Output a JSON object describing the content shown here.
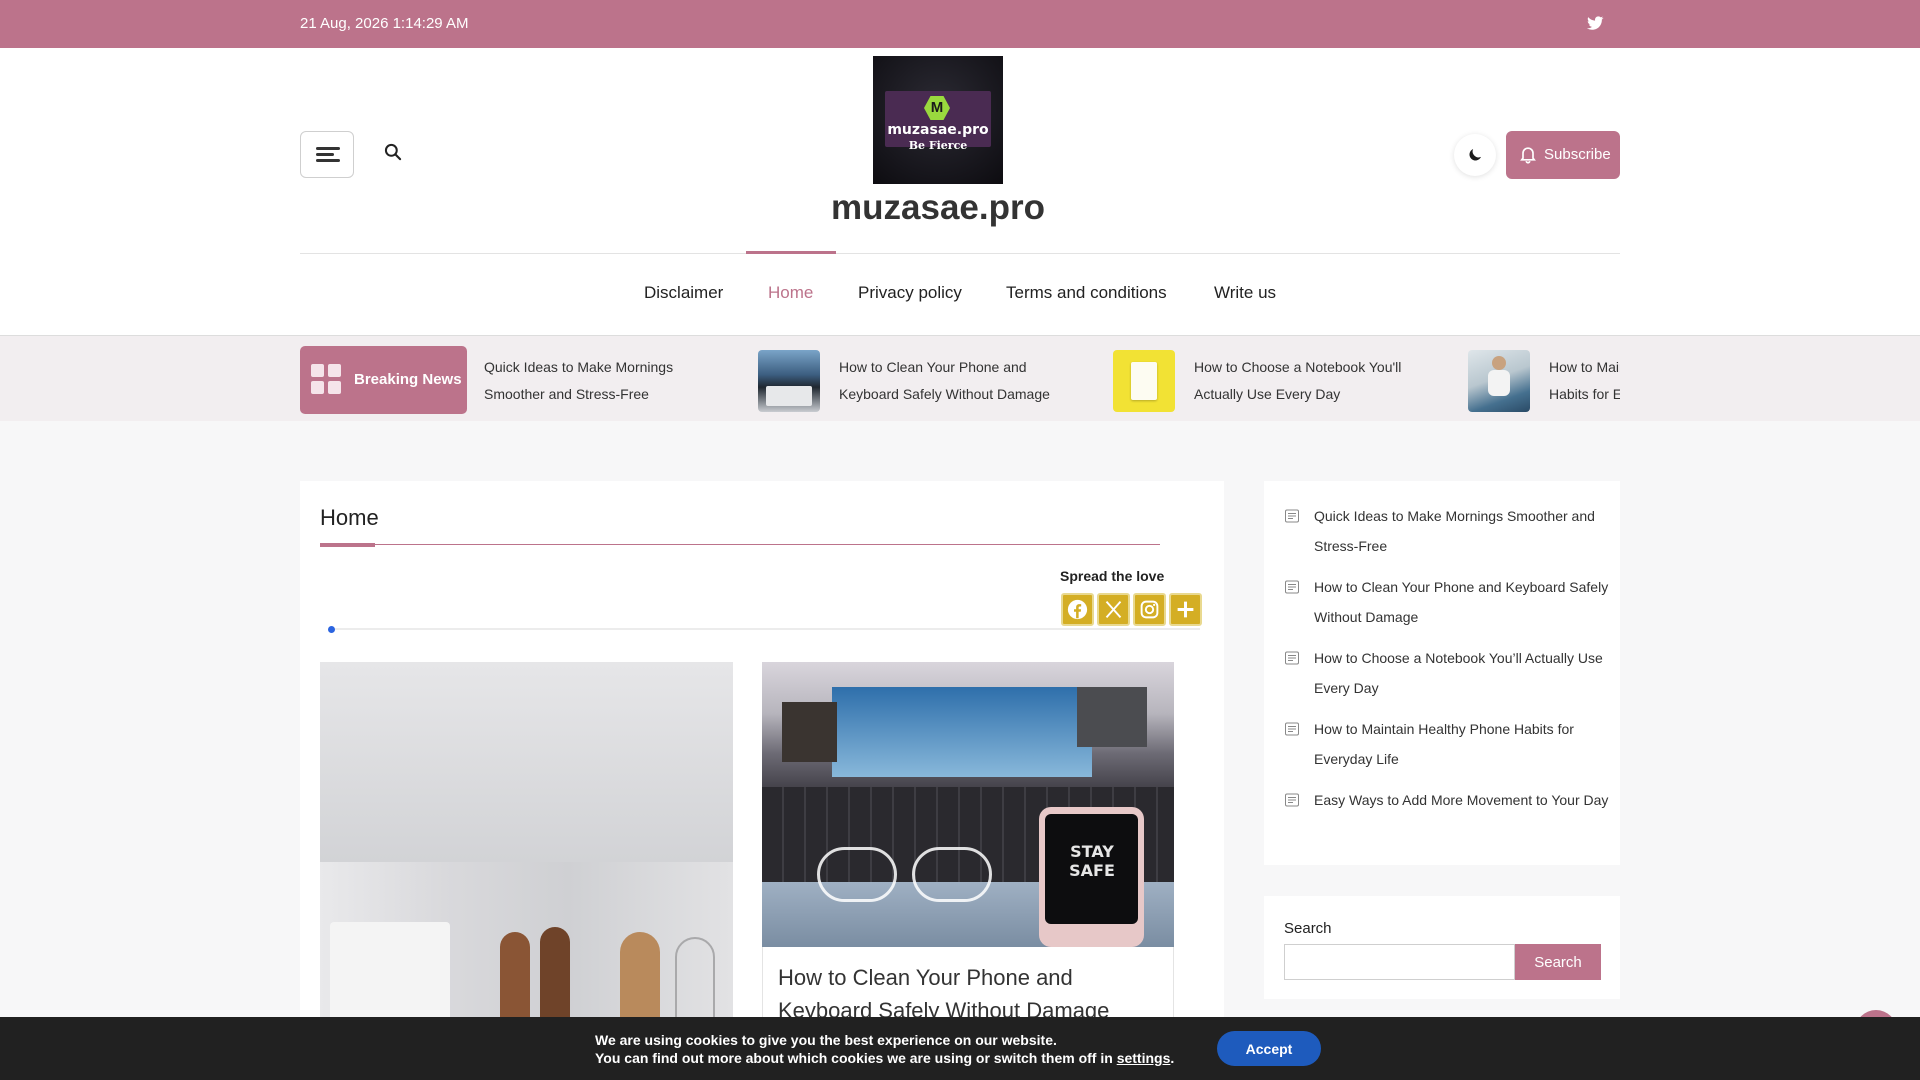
{
  "topbar": {
    "datetime": "21 Aug, 2026 1:14:29 AM",
    "social_icon": "twitter-icon",
    "bg_color": "#bc738b"
  },
  "header": {
    "logo": {
      "initial": "M",
      "name": "muzasae.pro",
      "slogan": "Be Fierce"
    },
    "site_title": "muzasae.pro",
    "subscribe_label": "Subscribe",
    "accent": "#bc738b"
  },
  "nav": {
    "items": [
      {
        "label": "Disclaimer",
        "active": false
      },
      {
        "label": "Home",
        "active": true
      },
      {
        "label": "Privacy policy",
        "active": false
      },
      {
        "label": "Terms and conditions",
        "active": false
      },
      {
        "label": "Write us",
        "active": false
      }
    ]
  },
  "ticker": {
    "label": "Breaking News",
    "items": [
      {
        "title": "Quick Ideas to Make Mornings Smoother and Stress-Free",
        "has_thumb": false
      },
      {
        "title": "How to Clean Your Phone and Keyboard Safely Without Damage",
        "has_thumb": true
      },
      {
        "title": "How to Choose a Notebook You'll Actually Use Every Day",
        "has_thumb": true
      },
      {
        "title": "How to Maintain Healthy Phone Habits for Everyday Life",
        "has_thumb": true
      }
    ]
  },
  "main": {
    "heading": "Home",
    "spread_label": "Spread the love",
    "share_buttons": [
      "facebook-icon",
      "x-icon",
      "instagram-icon",
      "plus-icon"
    ],
    "posts": [
      {
        "title": ""
      },
      {
        "title": "How to Clean Your Phone and Keyboard Safely Without Damage",
        "phone_text": "STAY SAFE"
      }
    ]
  },
  "sidebar": {
    "recent": [
      "Quick Ideas to Make Mornings Smoother and Stress-Free",
      "How to Clean Your Phone and Keyboard Safely Without Damage",
      "How to Choose a Notebook You’ll Actually Use Every Day",
      "How to Maintain Healthy Phone Habits for Everyday Life",
      "Easy Ways to Add More Movement to Your Day"
    ],
    "search": {
      "label": "Search",
      "button": "Search",
      "placeholder": ""
    }
  },
  "cookie": {
    "line1": "We are using cookies to give you the best experience on our website.",
    "line2_prefix": "You can find out more about which cookies we are using or switch them off in ",
    "line2_link": "settings",
    "line2_suffix": ".",
    "accept": "Accept"
  }
}
